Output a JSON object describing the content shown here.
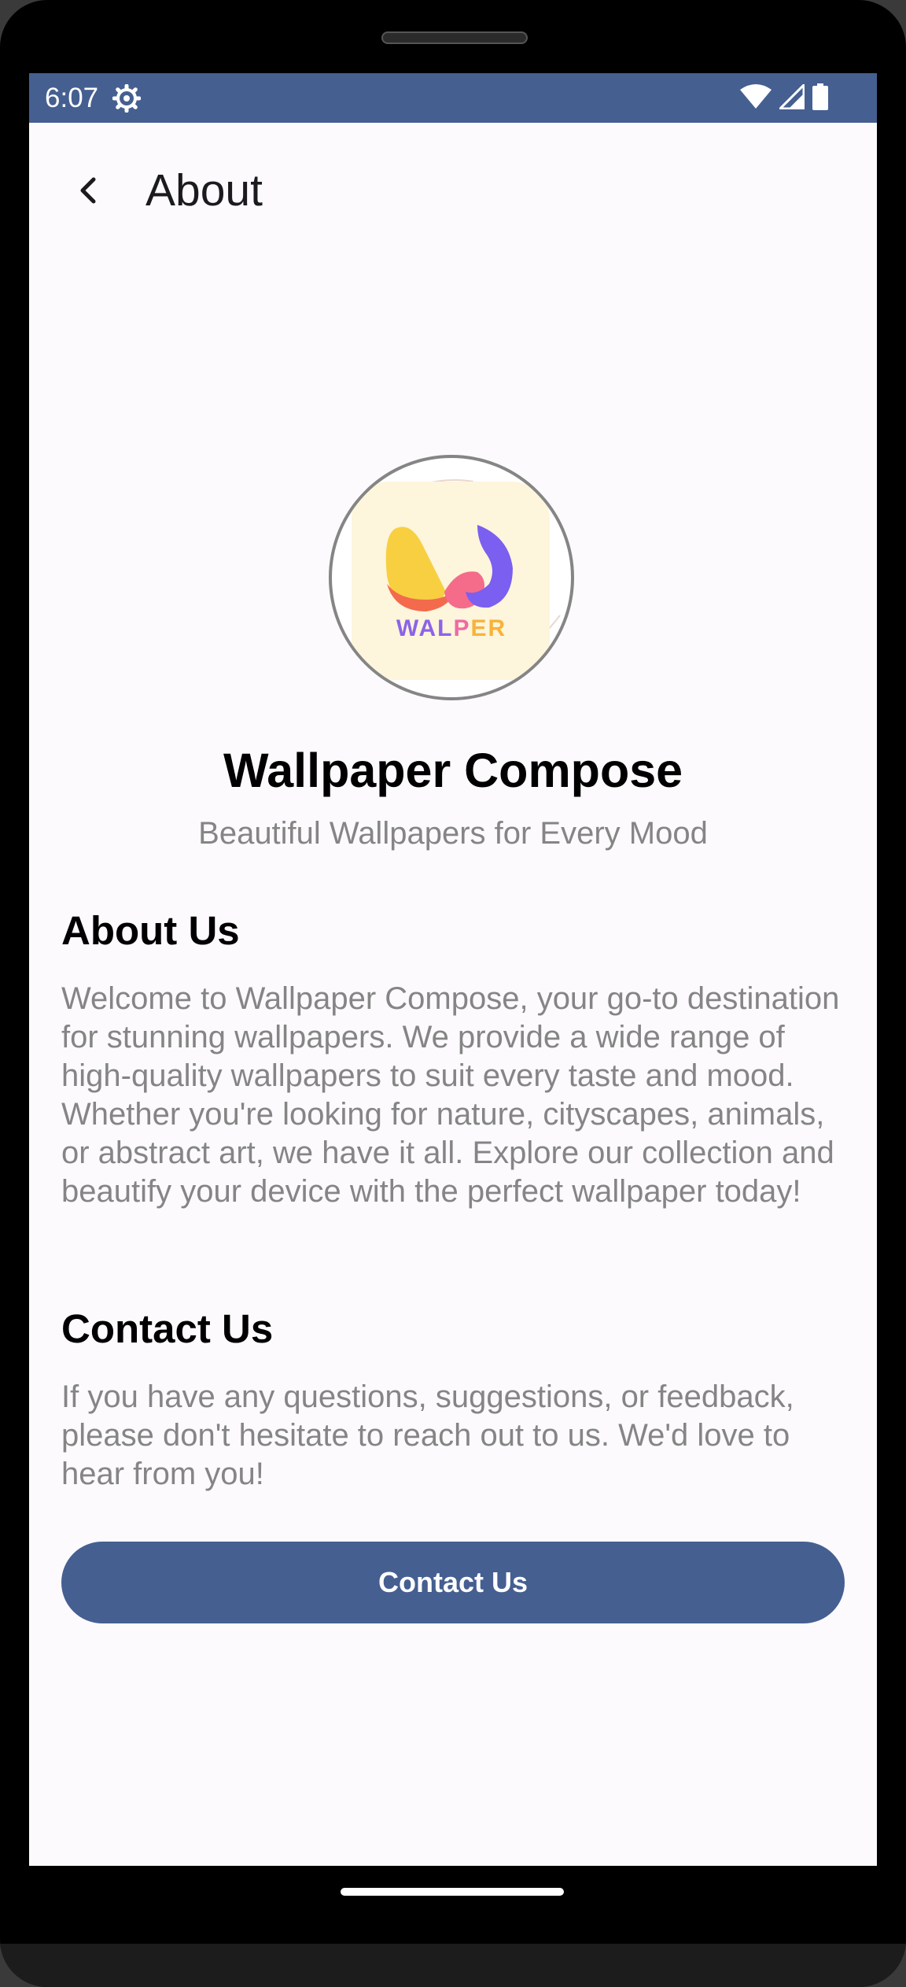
{
  "status_bar": {
    "time": "6:07",
    "icons": [
      "gear-icon",
      "wifi-icon",
      "signal-icon",
      "battery-icon"
    ],
    "background": "#455f91"
  },
  "app_bar": {
    "back_icon": "back-arrow-icon",
    "title": "About"
  },
  "logo": {
    "text": "WALPER",
    "background": "#fdf5dc"
  },
  "header": {
    "app_name": "Wallpaper Compose",
    "tagline": "Beautiful Wallpapers for Every Mood"
  },
  "about": {
    "title": "About Us",
    "body": "Welcome to Wallpaper Compose, your go-to destination for stunning wallpapers. We provide a wide range of high-quality wallpapers to suit every taste and mood. Whether you're looking for nature, cityscapes, animals, or abstract art, we have it all. Explore our collection and beautify your device with the perfect wallpaper today!"
  },
  "contact": {
    "title": "Contact Us",
    "body": "If you have any questions, suggestions, or feedback, please don't hesitate to reach out to us. We'd love to hear from you!",
    "button_label": "Contact Us",
    "button_color": "#455f91"
  }
}
